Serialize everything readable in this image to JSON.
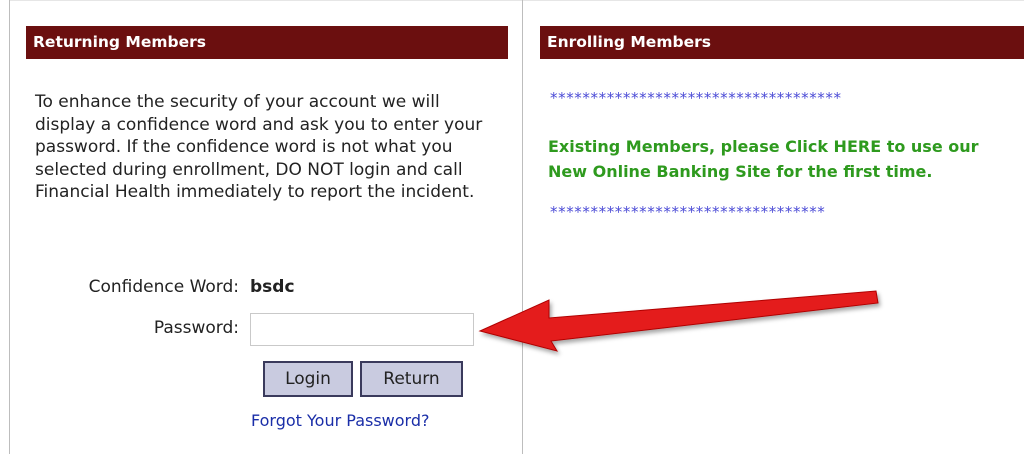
{
  "returning": {
    "header": "Returning Members",
    "intro": "To enhance the security of your account we will display a confidence word and ask you to enter your password. If the confidence word is not what you selected during enrollment, DO NOT login and call Financial Health immediately to report the incident.",
    "confidence_label": "Confidence Word:",
    "confidence_value": "bsdc",
    "password_label": "Password:",
    "password_value": "",
    "password_placeholder": "",
    "login_button": "Login",
    "return_button": "Return",
    "forgot_link": "Forgot Your Password?"
  },
  "enrolling": {
    "header": "Enrolling Members",
    "stars_top": "************************************",
    "message": "Existing Members, please Click HERE to use our New Online Banking Site for the first time.",
    "stars_bottom": "**********************************"
  },
  "colors": {
    "header_bg": "#6b0f0f",
    "button_bg": "#c9cbe0",
    "link": "#1a2ea8",
    "message": "#2e9a1e",
    "stars": "#4b4bd6",
    "arrow": "#e41e1e"
  },
  "annotation": {
    "arrow_icon": "red-arrow-pointing-at-password"
  }
}
